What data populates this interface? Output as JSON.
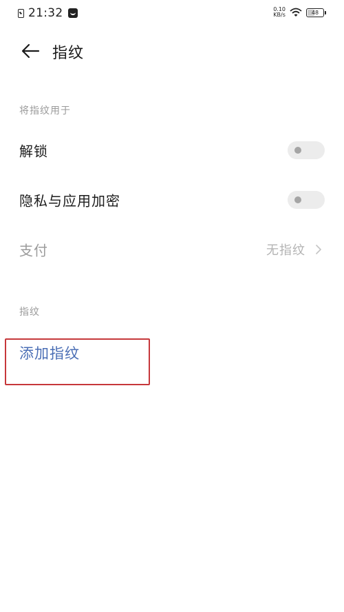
{
  "status_bar": {
    "time": "21:32",
    "net_speed_value": "0.10",
    "net_speed_unit": "KB/s",
    "battery": "48",
    "battery_level": 0.48
  },
  "header": {
    "title": "指纹"
  },
  "section_use_for": {
    "label": "将指纹用于",
    "items": [
      {
        "label": "解锁",
        "control": "toggle",
        "on": false
      },
      {
        "label": "隐私与应用加密",
        "control": "toggle",
        "on": false
      },
      {
        "label": "支付",
        "control": "link",
        "value": "无指纹",
        "enabled": false
      }
    ]
  },
  "section_fingerprints": {
    "label": "指纹",
    "add_label": "添加指纹"
  },
  "colors": {
    "accent": "#4a6eb5",
    "highlight_border": "#c6373a"
  }
}
